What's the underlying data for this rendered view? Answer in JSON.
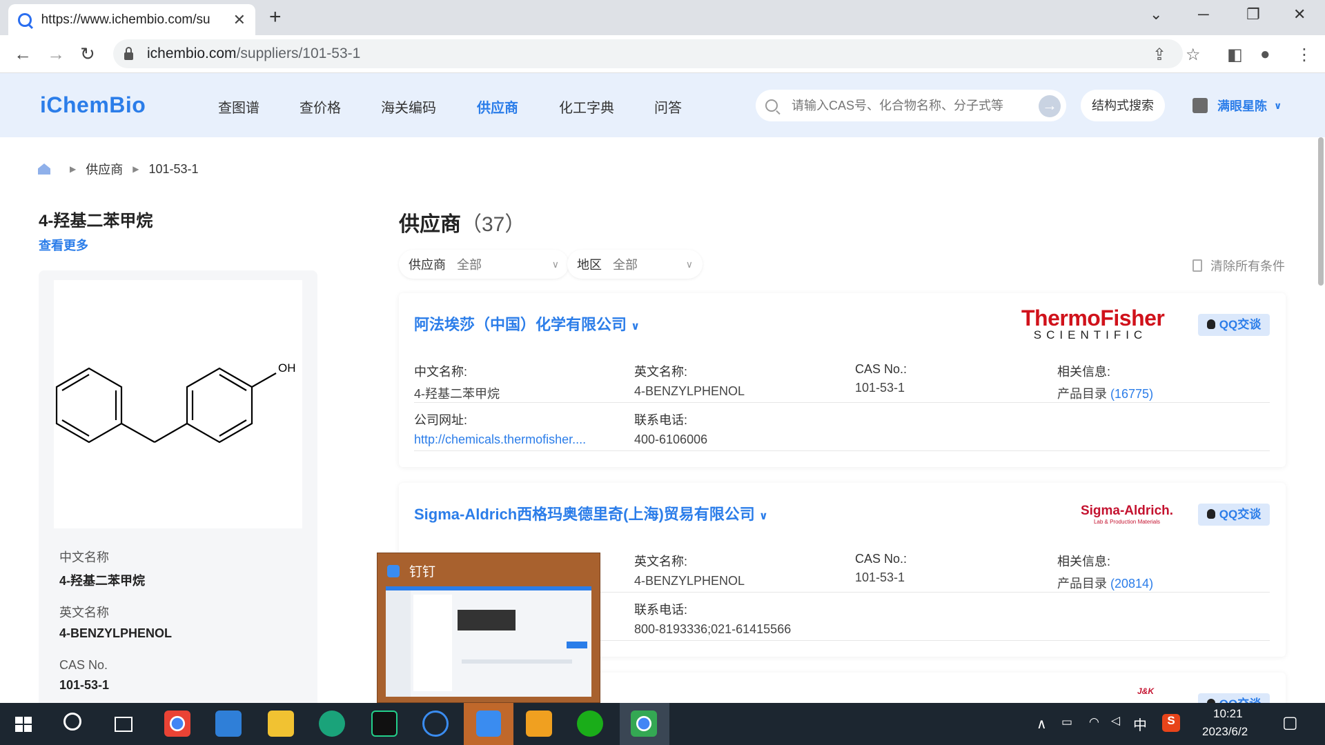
{
  "browser": {
    "tab_title": "https://www.ichembio.com/su",
    "tab_close": "✕",
    "new_tab": "+",
    "url_domain": "ichembio.com",
    "url_path": "/suppliers/101-53-1"
  },
  "header": {
    "logo": "iChemBio",
    "menu": [
      "查图谱",
      "查价格",
      "海关编码",
      "供应商",
      "化工字典",
      "问答"
    ],
    "active_menu": "供应商",
    "search_placeholder": "请输入CAS号、化合物名称、分子式等",
    "struct_search": "结构式搜索",
    "username": "满眼星陈"
  },
  "breadcrumb": {
    "level1": "供应商",
    "level2": "101-53-1"
  },
  "compound": {
    "title": "4-羟基二苯甲烷",
    "more": "查看更多",
    "oh_label": "OH",
    "props": [
      {
        "k": "中文名称",
        "v": "4-羟基二苯甲烷"
      },
      {
        "k": "英文名称",
        "v": "4-BENZYLPHENOL"
      },
      {
        "k": "CAS No.",
        "v": "101-53-1"
      }
    ]
  },
  "main": {
    "title": "供应商",
    "count": "（37）",
    "filter_supplier_label": "供应商",
    "filter_supplier_value": "全部",
    "filter_region_label": "地区",
    "filter_region_value": "全部",
    "clear": "清除所有条件"
  },
  "suppliers": [
    {
      "name": "阿法埃莎（中国）化学有限公司",
      "brand_line1": "ThermoFisher",
      "brand_line2": "SCIENTIFIC",
      "qq": "QQ交谈",
      "cn_name_label": "中文名称:",
      "cn_name": "4-羟基二苯甲烷",
      "en_name_label": "英文名称:",
      "en_name": "4-BENZYLPHENOL",
      "cas_label": "CAS No.:",
      "cas": "101-53-1",
      "info_label": "相关信息:",
      "info_prefix": "产品目录 ",
      "info_count": "(16775)",
      "site_label": "公司网址:",
      "site": "http://chemicals.thermofisher....",
      "phone_label": "联系电话:",
      "phone": "400-6106006"
    },
    {
      "name": "Sigma-Aldrich西格玛奥德里奇(上海)贸易有限公司",
      "brand_line1": "Sigma-Aldrich.",
      "brand_line2": "Lab & Production Materials",
      "qq": "QQ交谈",
      "en_name_label": "英文名称:",
      "en_name": "4-BENZYLPHENOL",
      "cas_label": "CAS No.:",
      "cas": "101-53-1",
      "info_label": "相关信息:",
      "info_prefix": "产品目录 ",
      "info_count": "(20814)",
      "phone_label": "联系电话:",
      "phone": "800-8193336;021-61415566"
    },
    {
      "brand": "J&K",
      "qq": "QQ交谈"
    }
  ],
  "popup": {
    "title": "钉钉"
  },
  "taskbar": {
    "ime": "中",
    "time": "10:21",
    "date": "2023/6/2"
  }
}
